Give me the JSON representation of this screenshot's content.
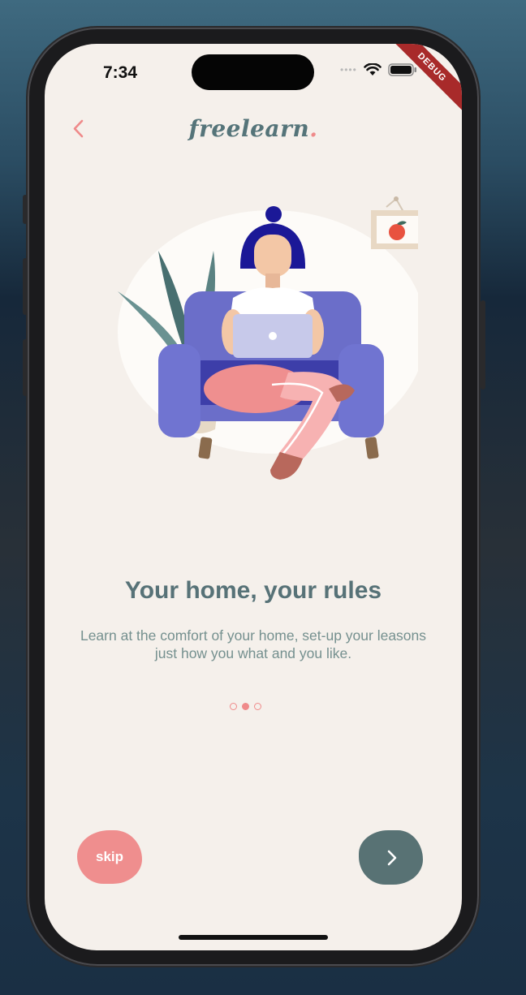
{
  "status_bar": {
    "time": "7:34",
    "signal_icon": "signal-dots-icon",
    "wifi_icon": "wifi-icon",
    "battery_icon": "battery-icon"
  },
  "debug_banner": "DEBUG",
  "header": {
    "back_icon": "chevron-left-icon",
    "logo_text": "freelearn",
    "logo_dot": "."
  },
  "onboarding": {
    "headline": "Your home, your rules",
    "description": "Learn at the comfort of your home, set-up your leasons just how you what and you like.",
    "page_indicator": {
      "total": 3,
      "active_index": 1
    }
  },
  "buttons": {
    "skip_label": "skip",
    "next_icon": "chevron-right-icon"
  },
  "colors": {
    "background": "#f5f0eb",
    "accent_pink": "#ef8a8a",
    "accent_teal": "#587274",
    "text_heading": "#577277",
    "text_body": "#75908f"
  }
}
